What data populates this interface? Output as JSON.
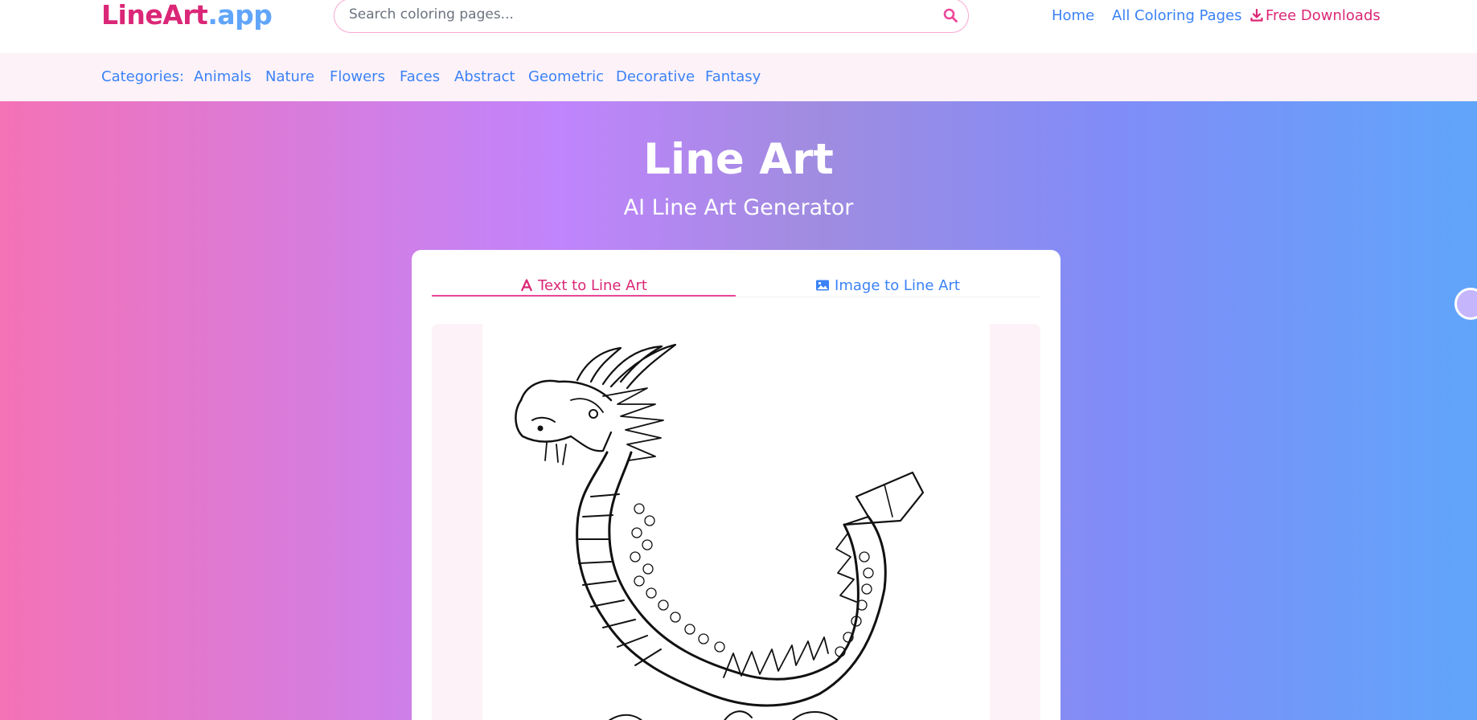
{
  "header": {
    "logo_brand": "LineArt",
    "logo_tld": ".app",
    "search_placeholder": "Search coloring pages...",
    "nav": {
      "home": "Home",
      "all_pages": "All Coloring Pages",
      "downloads": "Free Downloads"
    }
  },
  "categories": {
    "label": "Categories:",
    "items": [
      "Animals",
      "Nature",
      "Flowers",
      "Faces",
      "Abstract",
      "Geometric",
      "Decorative",
      "Fantasy"
    ]
  },
  "hero": {
    "title": "Line Art",
    "subtitle": "AI Line Art Generator"
  },
  "tabs": [
    {
      "label": "Text to Line Art",
      "icon": "font-a-icon",
      "active": true
    },
    {
      "label": "Image to Line Art",
      "icon": "image-icon",
      "active": false
    }
  ],
  "preview": {
    "image": "dragon-line-art-icon"
  },
  "colors": {
    "brand_pink": "#db2777",
    "accent_blue": "#3b82f6",
    "gradient_start": "#f472b6",
    "gradient_end": "#60a5fa"
  }
}
